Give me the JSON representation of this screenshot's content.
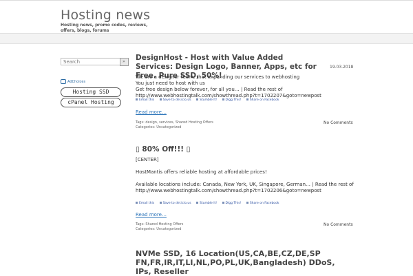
{
  "site": {
    "title": "Hosting news",
    "description": "Hosting news, promo codes, reviews, offers, blogs, forums"
  },
  "sidebar": {
    "search_placeholder": "Search",
    "adchoices": "AdChoices",
    "ads": [
      "Hosting SSD",
      "cPanel Hosting"
    ]
  },
  "share_labels": [
    "Email this",
    "Save to del.icio.us",
    "Stumble It!",
    "Digg This!",
    "Share on Facebook"
  ],
  "posts": [
    {
      "title": "DesignHost - Host with Value Added Services: Design Logo, Banner, Apps, etc for Free. Pure SSD, 50%!",
      "date": "19.03.2018",
      "body": [
        "We are a designer team, that expanding our services to webhosting",
        "You just need to host with us",
        "Get free design below forever, for all you… | Read the rest of http://www.webhostingtalk.com/showthread.php?t=1702207&goto=newpost"
      ],
      "read_more": "Read more…",
      "tags_label": "Tags:",
      "tags": "design, services, Shared Hosting Offers",
      "categories_label": "Categories:",
      "categories": "Uncategorized",
      "comments": "No Comments"
    },
    {
      "title": "▯ 80% Off!!! ▯",
      "body": [
        "[CENTER]",
        "HostMantis offers reliable hosting at affordable prices!",
        "Available locations include: Canada, New York, UK, Singapore, German… | Read the rest of http://www.webhostingtalk.com/showthread.php?t=1702206&goto=newpost"
      ],
      "read_more": "Read more…",
      "tags_label": "Tags:",
      "tags": "Shared Hosting Offers",
      "categories_label": "Categories:",
      "categories": "Uncategorized",
      "comments": "No Comments"
    },
    {
      "title": "NVMe SSD, 16 Location(US,CA,BE,CZ,DE,SP FN,FR,IR,IT,LI,NL,PO,PL,UK,Bangladesh) DDoS, IPs, Reseller"
    }
  ]
}
